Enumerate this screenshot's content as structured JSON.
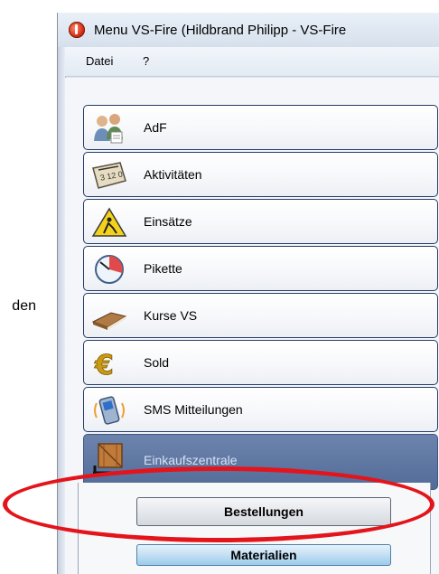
{
  "left_text": "den",
  "window": {
    "title": "Menu VS-Fire    (Hildbrand Philipp - VS-Fire"
  },
  "menubar": [
    {
      "label": "Datei"
    },
    {
      "label": "?"
    }
  ],
  "nav": [
    {
      "label": "AdF",
      "icon": "people-icon"
    },
    {
      "label": "Aktivitäten",
      "icon": "calendar-icon"
    },
    {
      "label": "Einsätze",
      "icon": "roadwork-sign-icon"
    },
    {
      "label": "Pikette",
      "icon": "clock-icon"
    },
    {
      "label": "Kurse VS",
      "icon": "book-icon"
    },
    {
      "label": "Sold",
      "icon": "euro-icon"
    },
    {
      "label": "SMS Mitteilungen",
      "icon": "mobile-phone-icon"
    },
    {
      "label": "Einkaufszentrale",
      "icon": "shipping-crate-icon",
      "active": true
    }
  ],
  "sub_buttons": [
    {
      "label": "Bestellungen"
    },
    {
      "label": "Materialien"
    }
  ],
  "colors": {
    "highlight": "#e3141b",
    "active_button": "#536c98",
    "button_border": "#243a66"
  }
}
